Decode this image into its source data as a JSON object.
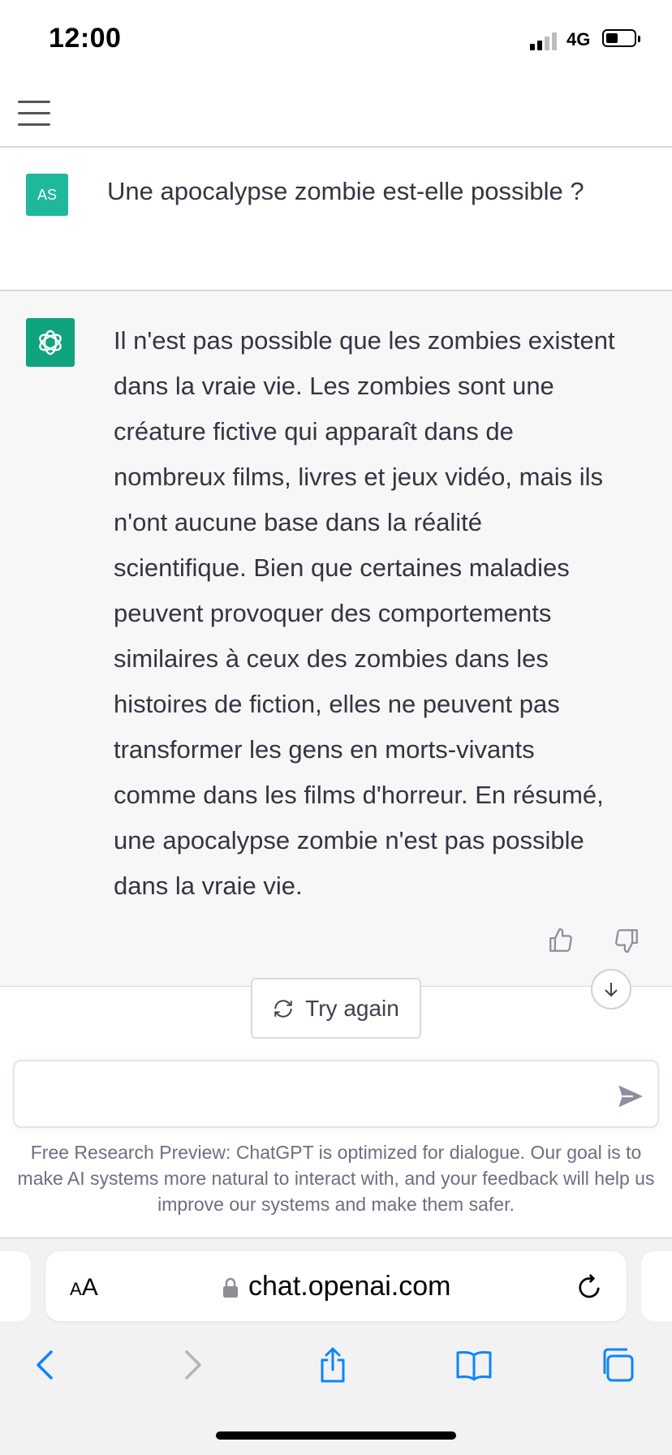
{
  "status_bar": {
    "time": "12:00",
    "network": "4G"
  },
  "conversation": {
    "user_initials": "AS",
    "question": "Une apocalypse zombie est-elle possible ?",
    "answer_lines": [
      "Il n'est pas possible que les zombies existent",
      "dans la vraie vie. Les zombies sont une",
      "créature fictive qui apparaît dans de",
      "nombreux films, livres et jeux vidéo, mais ils",
      "n'ont aucune base dans la réalité",
      "scientifique. Bien que certaines maladies",
      "peuvent provoquer des comportements",
      "similaires à ceux des zombies dans les",
      "histoires de fiction, elles ne peuvent pas",
      "transformer les gens en morts-vivants",
      "comme dans les films d'horreur. En résumé,",
      "une apocalypse zombie n'est pas possible",
      "dans la vraie vie."
    ]
  },
  "actions": {
    "try_again_label": "Try again"
  },
  "composer": {
    "value": "",
    "placeholder": ""
  },
  "disclaimer": "Free Research Preview: ChatGPT is optimized for dialogue. Our goal is to make AI systems more natural to interact with, and your feedback will help us improve our systems and make them safer.",
  "browser": {
    "text_size_small": "A",
    "text_size_large": "A",
    "url": "chat.openai.com"
  },
  "colors": {
    "user_avatar": "#1fb89a",
    "assistant_avatar": "#10a37f",
    "assistant_bg": "#f7f7f8",
    "safari_blue": "#0a84ff"
  },
  "icons": [
    "hamburger-menu-icon",
    "openai-logo-icon",
    "thumbs-up-icon",
    "thumbs-down-icon",
    "refresh-icon",
    "arrow-down-icon",
    "send-icon",
    "lock-icon",
    "reload-icon",
    "back-icon",
    "forward-icon",
    "share-icon",
    "bookmarks-icon",
    "tabs-icon"
  ]
}
